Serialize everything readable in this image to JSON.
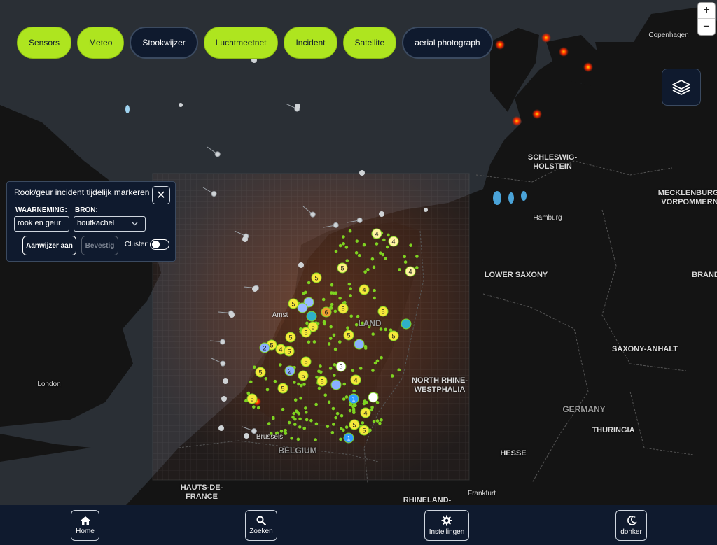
{
  "chips": [
    {
      "label": "Sensors",
      "active": true
    },
    {
      "label": "Meteo",
      "active": true
    },
    {
      "label": "Stookwijzer",
      "active": false
    },
    {
      "label": "Luchtmeetnet",
      "active": true
    },
    {
      "label": "Incident",
      "active": true
    },
    {
      "label": "Satellite",
      "active": true
    },
    {
      "label": "aerial photograph",
      "active": false
    }
  ],
  "zoom": {
    "in": "+",
    "out": "−"
  },
  "panel": {
    "title": "Rook/geur incident tijdelijk markeren",
    "close": "✕",
    "waarneming_label": "WAARNEMING:",
    "waarneming_value": "rook en geur",
    "bron_label": "BRON:",
    "bron_value": "houtkachel",
    "pointer_button": "Aanwijzer aan",
    "confirm_button": "Bevestig",
    "cluster_label": "Cluster:"
  },
  "places": [
    {
      "name": "Copenhagen",
      "type": "city"
    },
    {
      "name": "SCHLESWIG-\nHOLSTEIN",
      "type": "region"
    },
    {
      "name": "MECKLENBURG-\nVORPOMMERN",
      "type": "region"
    },
    {
      "name": "Hamburg",
      "type": "city"
    },
    {
      "name": "LOWER SAXONY",
      "type": "region"
    },
    {
      "name": "BRAND",
      "type": "region"
    },
    {
      "name": "SAXONY-ANHALT",
      "type": "region"
    },
    {
      "name": "NORTH RHINE-\nWESTPHALIA",
      "type": "region"
    },
    {
      "name": "GERMANY",
      "type": "country"
    },
    {
      "name": "THURINGIA",
      "type": "region"
    },
    {
      "name": "HESSE",
      "type": "region"
    },
    {
      "name": "Frankfurt",
      "type": "city"
    },
    {
      "name": "RHINELAND-",
      "type": "region"
    },
    {
      "name": "London",
      "type": "city"
    },
    {
      "name": "Brussels",
      "type": "city"
    },
    {
      "name": "BELGIUM",
      "type": "country"
    },
    {
      "name": "HAUTS-DE-\nFRANCE",
      "type": "region"
    },
    {
      "name": "Amst",
      "type": "city"
    },
    {
      "name": "LAND",
      "type": "country"
    }
  ],
  "cluster_labels": [
    "5",
    "6",
    "4",
    "3",
    "2",
    "1"
  ],
  "nav": [
    {
      "label": "Home",
      "icon": "home-icon"
    },
    {
      "label": "Zoeken",
      "icon": "search-icon"
    },
    {
      "label": "Instellingen",
      "icon": "gear-icon"
    },
    {
      "label": "donker",
      "icon": "moon-icon"
    }
  ],
  "colors": {
    "accent": "#aee51f",
    "panel": "#0f1a2e",
    "sensor_dot": "#7ed321",
    "fire": "#ff2b00"
  }
}
